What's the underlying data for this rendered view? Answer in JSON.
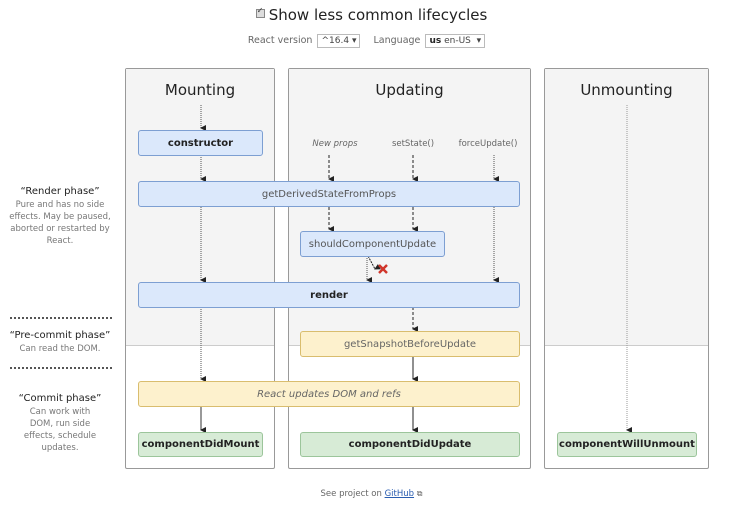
{
  "header": {
    "checkbox_label": "Show less common lifecycles",
    "checkbox_checked": true,
    "react_version_label": "React version",
    "react_version_value": "^16.4",
    "language_label": "Language",
    "language_flag": "us",
    "language_value": "en-US"
  },
  "phases": [
    {
      "title": "“Render phase”",
      "description": "Pure and has no side effects. May be paused, aborted or restarted by React."
    },
    {
      "title": "“Pre-commit phase”",
      "description": "Can read the DOM."
    },
    {
      "title": "“Commit phase”",
      "description": "Can work with DOM, run side effects, schedule updates."
    }
  ],
  "columns": {
    "mounting": "Mounting",
    "updating": "Updating",
    "unmounting": "Unmounting"
  },
  "sources": {
    "new_props": "New props",
    "set_state": "setState()",
    "force_update": "forceUpdate()"
  },
  "methods": {
    "constructor": "constructor",
    "get_derived_state": "getDerivedStateFromProps",
    "should_component_update": "shouldComponentUpdate",
    "render": "render",
    "get_snapshot": "getSnapshotBeforeUpdate",
    "react_updates": "React updates DOM and refs",
    "component_did_mount": "componentDidMount",
    "component_did_update": "componentDidUpdate",
    "component_will_unmount": "componentWillUnmount"
  },
  "footer": {
    "text": "See project on",
    "link": "GitHub",
    "icon": "external-link-icon"
  },
  "colors": {
    "render_phase": "#dbe8fb",
    "pre_commit_phase": "#fdf1cd",
    "commit_phase": "#d7ebd6",
    "cancel_mark": "#d0352a"
  }
}
